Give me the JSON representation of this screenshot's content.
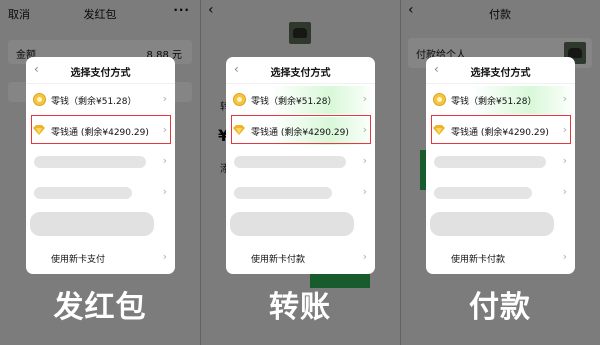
{
  "panels": [
    {
      "topbar": {
        "left": "取消",
        "title": "发红包",
        "right": "···"
      },
      "amount": {
        "label": "金额",
        "value": "8.88 元"
      },
      "sheet": {
        "title": "选择支付方式",
        "options": [
          {
            "label": "零钱（剩余¥51.28）",
            "icon": "coin-icon"
          },
          {
            "label": "零钱通 (剩余¥4290.29)",
            "icon": "gem-icon"
          }
        ],
        "bottom": "使用新卡支付"
      },
      "caption": "发红包"
    },
    {
      "topbar": {
        "left": "‹",
        "title": "",
        "right": ""
      },
      "bg_texts": {
        "t1": "转",
        "t2": "¥",
        "t3": "添"
      },
      "sheet": {
        "title": "选择支付方式",
        "options": [
          {
            "label": "零钱（剩余¥51.28）",
            "icon": "coin-icon"
          },
          {
            "label": "零钱通 (剩余¥4290.29)",
            "icon": "gem-icon"
          }
        ],
        "bottom": "使用新卡付款"
      },
      "caption": "转账"
    },
    {
      "topbar": {
        "left": "‹",
        "title": "付款",
        "right": ""
      },
      "bg_texts": {
        "t1": "付款给个人"
      },
      "sheet": {
        "title": "选择支付方式",
        "options": [
          {
            "label": "零钱（剩余¥51.28）",
            "icon": "coin-icon"
          },
          {
            "label": "零钱通 (剩余¥4290.29)",
            "icon": "gem-icon"
          }
        ],
        "bottom": "使用新卡付款"
      },
      "caption": "付款"
    }
  ],
  "colors": {
    "highlight": "#e4393c",
    "caption": "#ffffff",
    "coin": "#f4c542"
  }
}
